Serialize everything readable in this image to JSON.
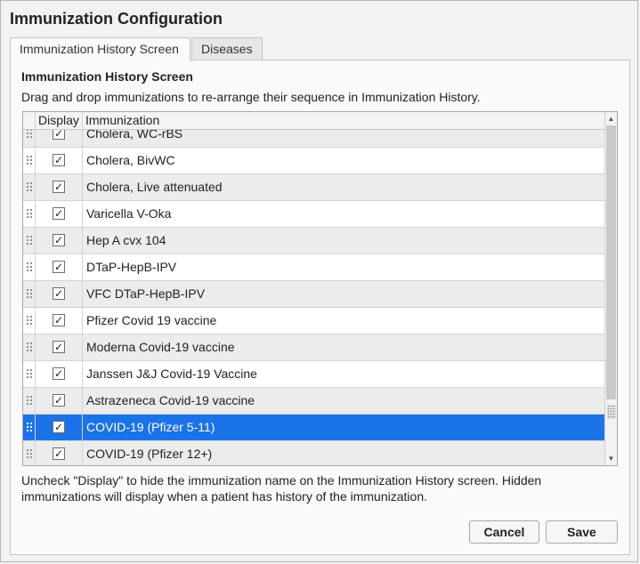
{
  "window": {
    "title": "Immunization Configuration"
  },
  "tabs": [
    {
      "label": "Immunization History Screen",
      "active": true
    },
    {
      "label": "Diseases",
      "active": false
    }
  ],
  "panel": {
    "heading": "Immunization History Screen",
    "description": "Drag and drop immunizations to re-arrange their sequence in Immunization History."
  },
  "grid": {
    "columns": {
      "display": "Display",
      "immunization": "Immunization"
    },
    "rows": [
      {
        "name": "Cholera, WC-rBS",
        "checked": true,
        "selected": false
      },
      {
        "name": "Cholera, BivWC",
        "checked": true,
        "selected": false
      },
      {
        "name": "Cholera, Live attenuated",
        "checked": true,
        "selected": false
      },
      {
        "name": "Varicella V-Oka",
        "checked": true,
        "selected": false
      },
      {
        "name": "Hep A cvx 104",
        "checked": true,
        "selected": false
      },
      {
        "name": "DTaP-HepB-IPV",
        "checked": true,
        "selected": false
      },
      {
        "name": "VFC DTaP-HepB-IPV",
        "checked": true,
        "selected": false
      },
      {
        "name": "Pfizer Covid 19 vaccine",
        "checked": true,
        "selected": false
      },
      {
        "name": "Moderna Covid-19 vaccine",
        "checked": true,
        "selected": false
      },
      {
        "name": "Janssen J&J Covid-19 Vaccine",
        "checked": true,
        "selected": false
      },
      {
        "name": "Astrazeneca  Covid-19 vaccine",
        "checked": true,
        "selected": false
      },
      {
        "name": "COVID-19 (Pfizer 5-11)",
        "checked": true,
        "selected": true
      },
      {
        "name": "COVID-19 (Pfizer 12+)",
        "checked": true,
        "selected": false
      }
    ]
  },
  "footer": {
    "note": "Uncheck \"Display\" to hide the immunization name on the Immunization History screen. Hidden immunizations will display when a patient has history of the immunization."
  },
  "buttons": {
    "cancel": "Cancel",
    "save": "Save"
  },
  "colors": {
    "selected_row": "#1a73e8",
    "alt_row": "#ececec"
  }
}
